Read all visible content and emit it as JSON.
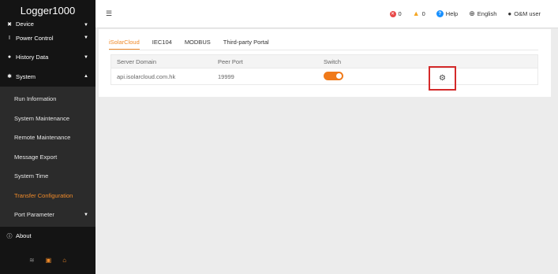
{
  "app": {
    "title": "Logger1000"
  },
  "sidebar": {
    "top_partial": {
      "label": "Device"
    },
    "items": [
      {
        "label": "Power Control",
        "icon": "power-control-icon"
      },
      {
        "label": "History Data",
        "icon": "history-icon"
      },
      {
        "label": "System",
        "icon": "gear-icon"
      }
    ],
    "system_sub": [
      {
        "label": "Run Information"
      },
      {
        "label": "System Maintenance"
      },
      {
        "label": "Remote Maintenance"
      },
      {
        "label": "Message Export"
      },
      {
        "label": "System Time"
      },
      {
        "label": "Transfer Configuration"
      },
      {
        "label": "Port Parameter"
      }
    ],
    "about": {
      "label": "About"
    },
    "footer_icons": [
      "wifi-icon",
      "monitor-icon",
      "cloud-icon"
    ]
  },
  "header": {
    "error_count": "0",
    "warning_count": "0",
    "help_label": "Help",
    "language": "English",
    "user": "O&M user"
  },
  "tabs": [
    {
      "label": "iSolarCloud",
      "active": true
    },
    {
      "label": "IEC104",
      "active": false
    },
    {
      "label": "MODBUS",
      "active": false
    },
    {
      "label": "Third-party Portal",
      "active": false
    }
  ],
  "table": {
    "columns": [
      "Server Domain",
      "Peer Port",
      "Switch"
    ],
    "rows": [
      {
        "server_domain": "api.isolarcloud.com.hk",
        "peer_port": "19999",
        "switch_on": true
      }
    ]
  },
  "colors": {
    "accent": "#f08a29",
    "highlight_box": "#d42a2a",
    "sidebar_bg": "#1f1f1f"
  }
}
